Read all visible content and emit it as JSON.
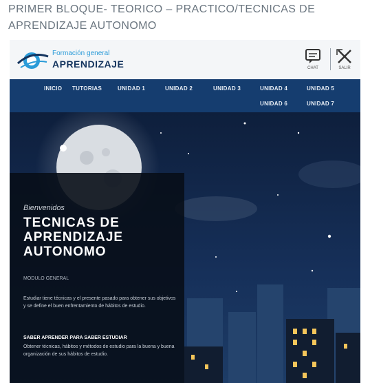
{
  "page": {
    "title": "PRIMER BLOQUE- TEORICO – PRACTICO/TECNICAS DE APRENDIZAJE AUTONOMO"
  },
  "header": {
    "logo_top": "Formación general",
    "logo_main": "APRENDIZAJE",
    "tools": [
      {
        "icon": "chat-bubble-icon",
        "caption": "CHAT"
      },
      {
        "icon": "close-window-icon",
        "caption": "SALIR"
      }
    ]
  },
  "nav": {
    "items": [
      "INICIO",
      "TUTORIAS",
      "UNIDAD 1",
      "UNIDAD 2",
      "UNIDAD 3",
      "UNIDAD 4",
      "UNIDAD 5",
      "UNIDAD 6",
      "UNIDAD 7"
    ]
  },
  "hero": {
    "kicker": "Bienvenidos",
    "title": "TECNICAS DE APRENDIZAJE AUTONOMO",
    "meta": "MODULO GENERAL",
    "description": "Estudiar tiene técnicas y el presente pasado para obtener sus objetivos y se define el buen enfrentamiento de hábitos de estudio.",
    "desc2_heading": "SABER APRENDER PARA SABER ESTUDIAR",
    "desc2": "Obtener técnicas, hábitos y métodos de estudio para la buena y buena organización de sus hábitos de estudio."
  },
  "colors": {
    "nav_bg": "#153d6f",
    "panel_bg": "#080e18",
    "logo_blue": "#2a9bd8",
    "logo_navy": "#14345e"
  }
}
